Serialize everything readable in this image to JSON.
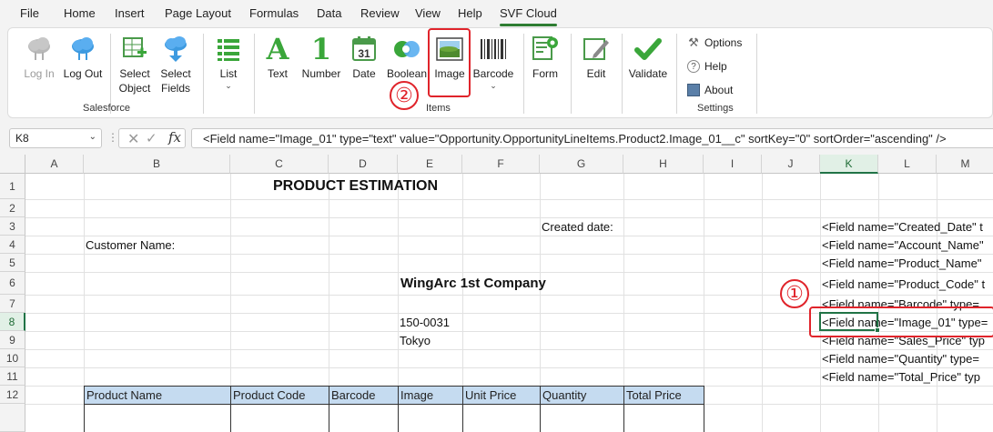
{
  "menu": {
    "items": [
      "File",
      "Home",
      "Insert",
      "Page Layout",
      "Formulas",
      "Data",
      "Review",
      "View",
      "Help",
      "SVF Cloud"
    ],
    "active": "SVF Cloud"
  },
  "ribbon": {
    "salesforce": {
      "label": "Salesforce",
      "login": "Log In",
      "logout": "Log Out",
      "select_object": [
        "Select",
        "Object"
      ],
      "select_fields": [
        "Select",
        "Fields"
      ]
    },
    "items": {
      "label": "Items",
      "list": "List",
      "text": "Text",
      "number": "Number",
      "date": "Date",
      "boolean": "Boolean",
      "image": "Image",
      "barcode": "Barcode",
      "form": "Form",
      "edit": "Edit",
      "validate": "Validate",
      "text_glyph": "A",
      "number_glyph": "1",
      "date_glyph": "31"
    },
    "settings": {
      "label": "Settings",
      "options": "Options",
      "help": "Help",
      "about": "About"
    }
  },
  "formula_bar": {
    "cell_ref": "K8",
    "formula": "<Field name=\"Image_01\" type=\"text\" value=\"Opportunity.OpportunityLineItems.Product2.Image_01__c\" sortKey=\"0\" sortOrder=\"ascending\" />"
  },
  "sheet": {
    "columns": [
      "A",
      "B",
      "C",
      "D",
      "E",
      "F",
      "G",
      "H",
      "I",
      "J",
      "K",
      "L",
      "M"
    ],
    "rows": [
      "1",
      "2",
      "3",
      "4",
      "5",
      "6",
      "7",
      "8",
      "9",
      "10",
      "11",
      "12"
    ],
    "selected_column": "K",
    "selected_row": "8",
    "title": "PRODUCT ESTIMATION",
    "created_date_label": "Created date:",
    "customer_name_label": "Customer Name:",
    "company": "WingArc 1st Company",
    "postal_code": "150-0031",
    "city": "Tokyo",
    "table_headers": [
      "Product Name",
      "Product Code",
      "Barcode",
      "Image",
      "Unit Price",
      "Quantity",
      "Total Price"
    ],
    "field_cells": [
      "<Field name=\"Created_Date\" t",
      "<Field name=\"Account_Name\"",
      "<Field name=\"Product_Name\"",
      "<Field name=\"Product_Code\" t",
      "<Field name=\"Barcode\" type=",
      "<Field name=\"Image_01\" type=",
      "<Field name=\"Sales_Price\" typ",
      "<Field name=\"Quantity\" type=",
      "<Field name=\"Total_Price\" typ"
    ]
  },
  "annotations": {
    "step1": "①",
    "step2": "②",
    "accent_color": "#e0242b"
  }
}
